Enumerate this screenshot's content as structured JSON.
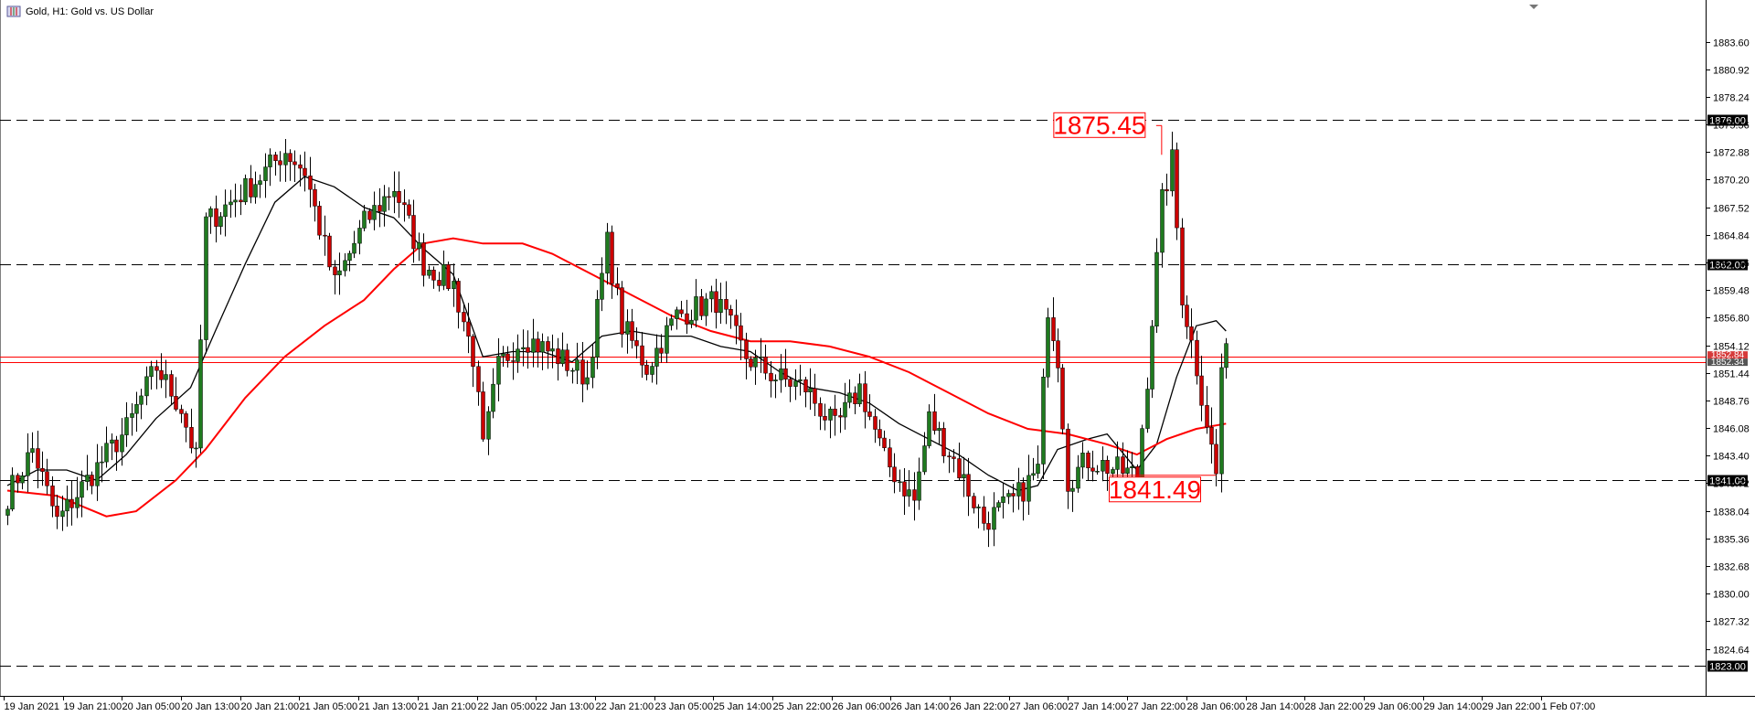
{
  "window": {
    "title": "Gold, H1:  Gold vs. US Dollar",
    "icon_name": "chart-window-icon"
  },
  "colors": {
    "background": "#ffffff",
    "bull_candle": "#1f7a1f",
    "bear_candle": "#cc0000",
    "wick": "#000000",
    "ma_fast": "#000000",
    "ma_slow": "#ff0000",
    "level_line": "#000000",
    "price_line": "#ff0000",
    "annotation": "#ff0000"
  },
  "chart_data": {
    "type": "candlestick",
    "symbol": "Gold",
    "timeframe": "H1",
    "title": "Gold, H1:  Gold vs. US Dollar",
    "ylim": [
      1821.4,
      1885.6
    ],
    "y_ticks": [
      "1883.60",
      "1880.92",
      "1878.24",
      "1875.56",
      "1872.88",
      "1870.20",
      "1867.52",
      "1864.84",
      "1862.16",
      "1859.48",
      "1856.80",
      "1854.12",
      "1851.44",
      "1848.76",
      "1846.08",
      "1843.40",
      "1840.72",
      "1838.04",
      "1835.36",
      "1832.68",
      "1830.00",
      "1827.32",
      "1824.64"
    ],
    "x_ticks": [
      "19 Jan 2021",
      "19 Jan 21:00",
      "20 Jan 05:00",
      "20 Jan 13:00",
      "20 Jan 21:00",
      "21 Jan 05:00",
      "21 Jan 13:00",
      "21 Jan 21:00",
      "22 Jan 05:00",
      "22 Jan 13:00",
      "22 Jan 21:00",
      "23 Jan 05:00",
      "25 Jan 14:00",
      "25 Jan 22:00",
      "26 Jan 06:00",
      "26 Jan 14:00",
      "26 Jan 22:00",
      "27 Jan 06:00",
      "27 Jan 14:00",
      "27 Jan 22:00",
      "28 Jan 06:00",
      "28 Jan 14:00",
      "28 Jan 22:00",
      "29 Jan 06:00",
      "29 Jan 14:00",
      "29 Jan 22:00",
      "1 Feb 07:00"
    ],
    "levels": [
      {
        "value": 1876.0,
        "label": "1876.00"
      },
      {
        "value": 1862.0,
        "label": "1862.00"
      },
      {
        "value": 1841.0,
        "label": "1841.00"
      },
      {
        "value": 1823.0,
        "label": "1823.00"
      }
    ],
    "price_lines": [
      {
        "value": 1853.0,
        "label": "1852.84"
      },
      {
        "value": 1852.5,
        "label": "1852.34"
      }
    ],
    "annotations": [
      {
        "text": "1875.45",
        "value": 1875.45,
        "bar": 233,
        "box": "left"
      },
      {
        "text": "1841.49",
        "value": 1841.49,
        "bar": 244,
        "box": "below"
      }
    ],
    "candle_spacing_px": 5.42,
    "anchor_points": [
      {
        "bar": 0,
        "price": 1839.5
      },
      {
        "bar": 5,
        "price": 1844.0
      },
      {
        "bar": 10,
        "price": 1837.0
      },
      {
        "bar": 16,
        "price": 1841.0
      },
      {
        "bar": 24,
        "price": 1846.0
      },
      {
        "bar": 30,
        "price": 1852.0
      },
      {
        "bar": 35,
        "price": 1848.0
      },
      {
        "bar": 38,
        "price": 1843.0
      },
      {
        "bar": 40,
        "price": 1866.0
      },
      {
        "bar": 45,
        "price": 1868.0
      },
      {
        "bar": 51,
        "price": 1870.5
      },
      {
        "bar": 56,
        "price": 1873.0
      },
      {
        "bar": 60,
        "price": 1871.0
      },
      {
        "bar": 66,
        "price": 1860.0
      },
      {
        "bar": 72,
        "price": 1866.0
      },
      {
        "bar": 78,
        "price": 1869.5
      },
      {
        "bar": 84,
        "price": 1862.0
      },
      {
        "bar": 90,
        "price": 1860.0
      },
      {
        "bar": 94,
        "price": 1853.0
      },
      {
        "bar": 96,
        "price": 1844.0
      },
      {
        "bar": 99,
        "price": 1852.0
      },
      {
        "bar": 104,
        "price": 1855.0
      },
      {
        "bar": 111,
        "price": 1853.0
      },
      {
        "bar": 117,
        "price": 1851.0
      },
      {
        "bar": 121,
        "price": 1864.0
      },
      {
        "bar": 124,
        "price": 1856.0
      },
      {
        "bar": 129,
        "price": 1852.0
      },
      {
        "bar": 135,
        "price": 1857.0
      },
      {
        "bar": 143,
        "price": 1858.5
      },
      {
        "bar": 149,
        "price": 1853.0
      },
      {
        "bar": 155,
        "price": 1851.0
      },
      {
        "bar": 161,
        "price": 1850.0
      },
      {
        "bar": 167,
        "price": 1846.0
      },
      {
        "bar": 172,
        "price": 1850.0
      },
      {
        "bar": 177,
        "price": 1843.0
      },
      {
        "bar": 183,
        "price": 1839.0
      },
      {
        "bar": 186,
        "price": 1847.0
      },
      {
        "bar": 191,
        "price": 1843.0
      },
      {
        "bar": 197,
        "price": 1837.0
      },
      {
        "bar": 203,
        "price": 1839.0
      },
      {
        "bar": 208,
        "price": 1842.0
      },
      {
        "bar": 210,
        "price": 1858.0
      },
      {
        "bar": 212,
        "price": 1853.0
      },
      {
        "bar": 214,
        "price": 1841.0
      },
      {
        "bar": 218,
        "price": 1843.0
      },
      {
        "bar": 224,
        "price": 1842.0
      },
      {
        "bar": 228,
        "price": 1841.5
      },
      {
        "bar": 230,
        "price": 1851.0
      },
      {
        "bar": 233,
        "price": 1868.0
      },
      {
        "bar": 235,
        "price": 1872.0
      },
      {
        "bar": 237,
        "price": 1859.0
      },
      {
        "bar": 240,
        "price": 1852.0
      },
      {
        "bar": 244,
        "price": 1841.49
      },
      {
        "bar": 245,
        "price": 1852.0
      },
      {
        "bar": 246,
        "price": 1853.0
      }
    ],
    "series": [
      {
        "name": "MA fast",
        "type": "line",
        "period": 14,
        "points": [
          {
            "bar": 0,
            "price": 1840.5
          },
          {
            "bar": 6,
            "price": 1842.0
          },
          {
            "bar": 12,
            "price": 1842.0
          },
          {
            "bar": 18,
            "price": 1841.0
          },
          {
            "bar": 24,
            "price": 1843.5
          },
          {
            "bar": 30,
            "price": 1847.0
          },
          {
            "bar": 37,
            "price": 1850.0
          },
          {
            "bar": 42,
            "price": 1855.5
          },
          {
            "bar": 48,
            "price": 1862.0
          },
          {
            "bar": 54,
            "price": 1868.0
          },
          {
            "bar": 60,
            "price": 1870.5
          },
          {
            "bar": 66,
            "price": 1869.5
          },
          {
            "bar": 72,
            "price": 1867.5
          },
          {
            "bar": 78,
            "price": 1866.5
          },
          {
            "bar": 84,
            "price": 1863.5
          },
          {
            "bar": 90,
            "price": 1861.0
          },
          {
            "bar": 96,
            "price": 1853.0
          },
          {
            "bar": 102,
            "price": 1853.5
          },
          {
            "bar": 108,
            "price": 1853.5
          },
          {
            "bar": 114,
            "price": 1852.5
          },
          {
            "bar": 120,
            "price": 1855.0
          },
          {
            "bar": 126,
            "price": 1855.5
          },
          {
            "bar": 132,
            "price": 1855.0
          },
          {
            "bar": 138,
            "price": 1855.0
          },
          {
            "bar": 144,
            "price": 1854.0
          },
          {
            "bar": 150,
            "price": 1853.5
          },
          {
            "bar": 156,
            "price": 1851.5
          },
          {
            "bar": 162,
            "price": 1850.0
          },
          {
            "bar": 168,
            "price": 1849.5
          },
          {
            "bar": 174,
            "price": 1848.5
          },
          {
            "bar": 180,
            "price": 1846.5
          },
          {
            "bar": 186,
            "price": 1845.0
          },
          {
            "bar": 192,
            "price": 1843.5
          },
          {
            "bar": 198,
            "price": 1841.5
          },
          {
            "bar": 204,
            "price": 1840.0
          },
          {
            "bar": 208,
            "price": 1840.5
          },
          {
            "bar": 212,
            "price": 1844.0
          },
          {
            "bar": 218,
            "price": 1845.0
          },
          {
            "bar": 222,
            "price": 1845.5
          },
          {
            "bar": 228,
            "price": 1842.0
          },
          {
            "bar": 232,
            "price": 1844.5
          },
          {
            "bar": 236,
            "price": 1851.0
          },
          {
            "bar": 240,
            "price": 1856.0
          },
          {
            "bar": 244,
            "price": 1856.5
          },
          {
            "bar": 246,
            "price": 1855.5
          }
        ]
      },
      {
        "name": "MA slow",
        "type": "line",
        "period": 50,
        "points": [
          {
            "bar": 0,
            "price": 1840.0
          },
          {
            "bar": 10,
            "price": 1839.5
          },
          {
            "bar": 20,
            "price": 1837.5
          },
          {
            "bar": 26,
            "price": 1838.0
          },
          {
            "bar": 34,
            "price": 1841.0
          },
          {
            "bar": 40,
            "price": 1844.0
          },
          {
            "bar": 48,
            "price": 1849.0
          },
          {
            "bar": 56,
            "price": 1853.0
          },
          {
            "bar": 64,
            "price": 1856.0
          },
          {
            "bar": 72,
            "price": 1858.5
          },
          {
            "bar": 78,
            "price": 1861.5
          },
          {
            "bar": 84,
            "price": 1864.0
          },
          {
            "bar": 90,
            "price": 1864.5
          },
          {
            "bar": 96,
            "price": 1864.0
          },
          {
            "bar": 104,
            "price": 1864.0
          },
          {
            "bar": 110,
            "price": 1863.0
          },
          {
            "bar": 118,
            "price": 1861.0
          },
          {
            "bar": 126,
            "price": 1859.0
          },
          {
            "bar": 134,
            "price": 1857.0
          },
          {
            "bar": 142,
            "price": 1855.5
          },
          {
            "bar": 150,
            "price": 1854.5
          },
          {
            "bar": 158,
            "price": 1854.5
          },
          {
            "bar": 166,
            "price": 1854.0
          },
          {
            "bar": 174,
            "price": 1853.0
          },
          {
            "bar": 182,
            "price": 1851.5
          },
          {
            "bar": 190,
            "price": 1849.5
          },
          {
            "bar": 198,
            "price": 1847.5
          },
          {
            "bar": 206,
            "price": 1846.0
          },
          {
            "bar": 214,
            "price": 1845.5
          },
          {
            "bar": 222,
            "price": 1844.5
          },
          {
            "bar": 228,
            "price": 1843.5
          },
          {
            "bar": 234,
            "price": 1845.0
          },
          {
            "bar": 240,
            "price": 1846.0
          },
          {
            "bar": 246,
            "price": 1846.5
          }
        ]
      }
    ]
  }
}
